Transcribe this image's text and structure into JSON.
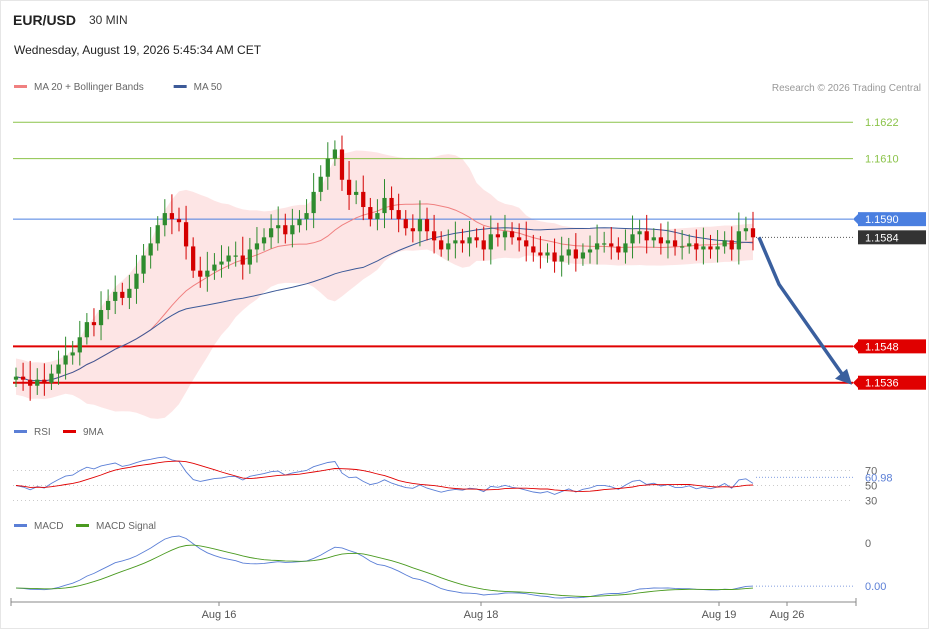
{
  "header": {
    "symbol": "EUR/USD",
    "timeframe": "30 MIN",
    "datetime": "Wednesday, August 19, 2026 5:45:34 AM CET",
    "copyright": "Research © 2026 Trading Central"
  },
  "colors": {
    "ma20": "#f08080",
    "ma50": "#3d5a98",
    "bbFill": "#fde0e0",
    "bull": "#2e8b2e",
    "bear": "#d40000",
    "green_level": "#8bc34a",
    "blue_level": "#4a7fe0",
    "red_level": "#e00000",
    "dark_label": "#333333",
    "arrow": "#3a5f9e",
    "rsi": "#5b7fd6",
    "rsi_ma": "#e00000",
    "macd": "#5b7fd6",
    "macd_signal": "#4a9a20"
  },
  "chart_data": [
    {
      "type": "candlestick",
      "legend": [
        {
          "name": "MA 20 + Bollinger Bands",
          "color": "#f08080"
        },
        {
          "name": "MA 50",
          "color": "#3d5a98"
        }
      ],
      "x_labels": [
        "Aug 16",
        "Aug 18",
        "Aug 19",
        "Aug 26"
      ],
      "ylim": [
        1.1526,
        1.163
      ],
      "levels": [
        {
          "value": "1.1622",
          "kind": "resistance",
          "color": "#8bc34a"
        },
        {
          "value": "1.1610",
          "kind": "resistance",
          "color": "#8bc34a"
        },
        {
          "value": "1.1590",
          "kind": "pivot",
          "color": "#4a7fe0"
        },
        {
          "value": "1.1584",
          "kind": "last",
          "color": "#333333"
        },
        {
          "value": "1.1548",
          "kind": "support",
          "color": "#e00000"
        },
        {
          "value": "1.1536",
          "kind": "support",
          "color": "#e00000"
        }
      ],
      "close": [
        1.1538,
        1.1537,
        1.1535,
        1.1537,
        1.1536,
        1.1539,
        1.1542,
        1.1545,
        1.1546,
        1.1551,
        1.1556,
        1.1555,
        1.156,
        1.1563,
        1.1566,
        1.1564,
        1.1567,
        1.1572,
        1.1578,
        1.1582,
        1.1588,
        1.1592,
        1.159,
        1.1589,
        1.1581,
        1.1573,
        1.1571,
        1.1573,
        1.1575,
        1.1576,
        1.1578,
        1.1578,
        1.1575,
        1.158,
        1.1582,
        1.1584,
        1.1587,
        1.1588,
        1.1585,
        1.1588,
        1.159,
        1.1592,
        1.1599,
        1.1604,
        1.161,
        1.1613,
        1.1603,
        1.1598,
        1.1599,
        1.1594,
        1.159,
        1.1592,
        1.1597,
        1.1593,
        1.159,
        1.1587,
        1.1586,
        1.159,
        1.1586,
        1.1583,
        1.158,
        1.1582,
        1.1583,
        1.1582,
        1.1584,
        1.1583,
        1.158,
        1.1585,
        1.1584,
        1.1586,
        1.1584,
        1.1583,
        1.1581,
        1.1579,
        1.1578,
        1.1579,
        1.1576,
        1.1578,
        1.158,
        1.1577,
        1.1579,
        1.158,
        1.1582,
        1.1582,
        1.1581,
        1.1579,
        1.1582,
        1.1585,
        1.1586,
        1.1583,
        1.1584,
        1.1582,
        1.1583,
        1.1581,
        1.1581,
        1.1582,
        1.158,
        1.1581,
        1.158,
        1.1581,
        1.1583,
        1.158,
        1.1586,
        1.1587,
        1.1584
      ],
      "rsi": {
        "name": "RSI",
        "ma_name": "9MA",
        "value": "60.98",
        "ticks": [
          "70",
          "50",
          "30"
        ],
        "ylim": [
          20,
          100
        ]
      },
      "macd": {
        "name": "MACD",
        "signal_name": "MACD Signal",
        "value": "0.00",
        "ticks": [
          "0"
        ],
        "zero_label": "0.00"
      }
    }
  ]
}
